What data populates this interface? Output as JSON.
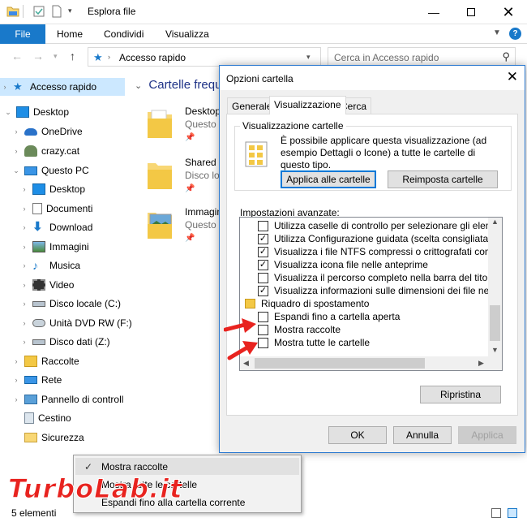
{
  "window": {
    "title": "Esplora file"
  },
  "ribbon": {
    "file": "File",
    "tabs": [
      "Home",
      "Condividi",
      "Visualizza"
    ]
  },
  "address": {
    "path": "Accesso rapido",
    "search_placeholder": "Cerca in Accesso rapido"
  },
  "nav": {
    "items": [
      {
        "label": "Accesso rapido",
        "icon": "star-icon"
      },
      {
        "label": "Desktop",
        "icon": "desktop-icon"
      },
      {
        "label": "OneDrive",
        "icon": "cloud-icon"
      },
      {
        "label": "crazy.cat",
        "icon": "user-icon"
      },
      {
        "label": "Questo PC",
        "icon": "computer-icon"
      },
      {
        "label": "Desktop",
        "icon": "desktop-icon"
      },
      {
        "label": "Documenti",
        "icon": "documents-icon"
      },
      {
        "label": "Download",
        "icon": "download-icon"
      },
      {
        "label": "Immagini",
        "icon": "pictures-icon"
      },
      {
        "label": "Musica",
        "icon": "music-icon"
      },
      {
        "label": "Video",
        "icon": "video-icon"
      },
      {
        "label": "Disco locale (C:)",
        "icon": "drive-icon"
      },
      {
        "label": "Unità DVD RW (F:)",
        "icon": "dvd-icon"
      },
      {
        "label": "Disco dati (Z:)",
        "icon": "drive-icon"
      },
      {
        "label": "Raccolte",
        "icon": "libraries-icon"
      },
      {
        "label": "Rete",
        "icon": "network-icon"
      },
      {
        "label": "Pannello di controll",
        "icon": "control-panel-icon"
      },
      {
        "label": "Cestino",
        "icon": "recycle-bin-icon"
      },
      {
        "label": "Sicurezza",
        "icon": "folder-icon"
      }
    ]
  },
  "content": {
    "section": "Cartelle freque",
    "folders": [
      {
        "name": "Desktop",
        "sub": "Questo P"
      },
      {
        "name": "Shared S",
        "sub": "Disco lo"
      },
      {
        "name": "Immagin",
        "sub": "Questo P"
      }
    ]
  },
  "status": {
    "count": "5 elementi"
  },
  "dialog": {
    "title": "Opzioni cartella",
    "tabs": [
      "Generale",
      "Visualizzazione",
      "Cerca"
    ],
    "group_title": "Visualizzazione cartelle",
    "group_text": "È possibile applicare questa visualizzazione (ad esempio Dettagli o Icone) a tutte le cartelle di questo tipo.",
    "apply_button": "Applica alle cartelle",
    "reset_button": "Reimposta cartelle",
    "advanced_label": "Impostazioni avanzate:",
    "options": [
      {
        "label": "Utilizza caselle di controllo per selezionare gli elementi",
        "checked": false,
        "type": "checkbox"
      },
      {
        "label": "Utilizza Configurazione guidata (scelta consigliata)",
        "checked": true,
        "type": "checkbox"
      },
      {
        "label": "Visualizza i file NTFS compressi o crittografati con un colo",
        "checked": true,
        "type": "checkbox"
      },
      {
        "label": "Visualizza icona file nelle anteprime",
        "checked": true,
        "type": "checkbox"
      },
      {
        "label": "Visualizza il percorso completo nella barra del titolo",
        "checked": false,
        "type": "checkbox"
      },
      {
        "label": "Visualizza informazioni sulle dimensioni dei file nei suggerir",
        "checked": true,
        "type": "checkbox"
      },
      {
        "label": "Riquadro di spostamento",
        "checked": false,
        "type": "heading"
      },
      {
        "label": "Espandi fino a cartella aperta",
        "checked": false,
        "type": "checkbox"
      },
      {
        "label": "Mostra raccolte",
        "checked": false,
        "type": "checkbox"
      },
      {
        "label": "Mostra tutte le cartelle",
        "checked": false,
        "type": "checkbox"
      }
    ],
    "restore_button": "Ripristina",
    "ok": "OK",
    "cancel": "Annulla",
    "apply": "Applica"
  },
  "context_menu": {
    "items": [
      {
        "label": "Mostra raccolte",
        "checked": true
      },
      {
        "label": "Mostra tutte le cartelle",
        "checked": false
      },
      {
        "label": "Espandi fino alla cartella corrente",
        "checked": false
      }
    ]
  },
  "watermark": {
    "text": "TurboLab.it"
  },
  "colors": {
    "accent": "#1979ca",
    "arrow": "#e8231f",
    "selection": "#cce8ff"
  }
}
